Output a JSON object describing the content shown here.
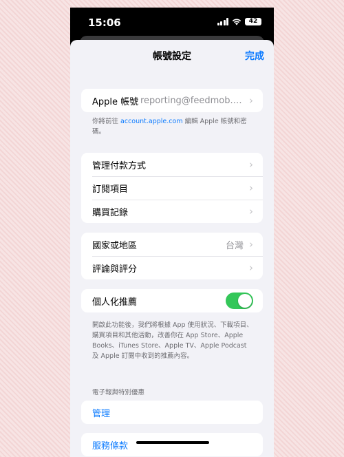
{
  "status_bar": {
    "time": "15:06",
    "battery": "42"
  },
  "nav": {
    "title": "帳號設定",
    "done": "完成"
  },
  "apple_id": {
    "label": "Apple 帳號",
    "value": "reporting@feedmob.co..."
  },
  "apple_id_note": {
    "prefix": "你將前往 ",
    "link": "account.apple.com",
    "suffix": " 編輯 Apple 帳號和密碼。"
  },
  "purchases": {
    "items": [
      {
        "label": "管理付款方式"
      },
      {
        "label": "訂閱項目"
      },
      {
        "label": "購買記錄"
      }
    ]
  },
  "region": {
    "items": [
      {
        "label": "國家或地區",
        "value": "台灣"
      },
      {
        "label": "評論與評分"
      }
    ]
  },
  "personalized": {
    "label": "個人化推薦",
    "enabled": true,
    "note": "開啟此功能後，我們將根據 App 使用狀況、下載項目、購買項目和其他活動，改善你在 App Store、Apple Books、iTunes Store、Apple TV、Apple Podcast 及 Apple 訂閱中收到的推薦內容。"
  },
  "newsletter": {
    "header": "電子報與特別優惠",
    "manage": "管理"
  },
  "terms": {
    "label": "服務條款"
  },
  "colors": {
    "accent": "#0a7aff",
    "toggle_on": "#34c759",
    "background": "#f2f2f7"
  },
  "icons": [
    "signal-icon",
    "wifi-icon",
    "battery-icon",
    "chevron-right-icon"
  ]
}
